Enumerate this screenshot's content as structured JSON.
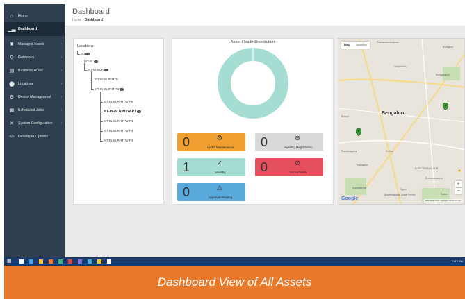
{
  "sidebar": {
    "items": [
      {
        "label": "Home",
        "icon": "home-icon",
        "glyph": "⌂",
        "chevron": ""
      },
      {
        "label": "Dashboard",
        "icon": "chart-icon",
        "glyph": "▁▃",
        "chevron": ""
      },
      {
        "label": "Managed Assets",
        "icon": "assets-icon",
        "glyph": "♜",
        "chevron": "›"
      },
      {
        "label": "Gateways",
        "icon": "usb-icon",
        "glyph": "⚲",
        "chevron": "›"
      },
      {
        "label": "Business Rules",
        "icon": "document-icon",
        "glyph": "▤",
        "chevron": "›"
      },
      {
        "label": "Locations",
        "icon": "map-marker-icon",
        "glyph": "⬤",
        "chevron": "›"
      },
      {
        "label": "Device Management",
        "icon": "gear-icon",
        "glyph": "⚙",
        "chevron": "›"
      },
      {
        "label": "Scheduled Jobs",
        "icon": "calendar-icon",
        "glyph": "▦",
        "chevron": "›"
      },
      {
        "label": "System Configuration",
        "icon": "wrench-icon",
        "glyph": "✕",
        "chevron": "›"
      },
      {
        "label": "Developer Options",
        "icon": "code-icon",
        "glyph": "</>",
        "chevron": ""
      }
    ]
  },
  "header": {
    "title": "Dashboard",
    "breadcrumb_home": "Home",
    "breadcrumb_sep": " › ",
    "breadcrumb_current": "Dashboard"
  },
  "locations": {
    "title": "Locations",
    "nodes": [
      {
        "label": "M1"
      },
      {
        "label": "MT-IN"
      },
      {
        "label": "MT-IN-BLR"
      },
      {
        "label": "MT-IN-BLR-MTE"
      },
      {
        "label": "MT-IN-BLR-MTW"
      },
      {
        "label": "MT-IN-BLR-MTW-P5"
      },
      {
        "label": "MT-IN-BLR-MTW-P1"
      },
      {
        "label": "MT-IN-BLR-MTW-P3"
      },
      {
        "label": "MT-IN-BLR-MTW-P4"
      },
      {
        "label": "MT-IN-BLR-MTW-P2"
      }
    ]
  },
  "asset_health": {
    "title": "Asset Health Distribution",
    "tiles": [
      {
        "count": "0",
        "label": "Under Maintenance",
        "icon": "wrench-gear-icon",
        "glyph": "⚙",
        "color": "#f0a030"
      },
      {
        "count": "0",
        "label": "Awaiting Registration",
        "icon": "minus-circle-icon",
        "glyph": "⊖",
        "color": "#d9d9d9"
      },
      {
        "count": "1",
        "label": "Healthy",
        "icon": "check-circle-icon",
        "glyph": "✓",
        "color": "#a6ddd2"
      },
      {
        "count": "0",
        "label": "Unreachable",
        "icon": "ban-icon",
        "glyph": "⊘",
        "color": "#e5505f"
      },
      {
        "count": "0",
        "label": "Approval Pending",
        "icon": "warning-icon",
        "glyph": "⚠",
        "color": "#5aa9dc"
      }
    ]
  },
  "chart_data": {
    "type": "pie",
    "title": "Asset Health Distribution",
    "categories": [
      "Healthy"
    ],
    "values": [
      1
    ],
    "colors": [
      "#a6ddd2"
    ]
  },
  "map": {
    "tab_map": "Map",
    "tab_satellite": "Satellite",
    "city": "Bengaluru",
    "labels": [
      "Ramachandrapura",
      "Budigere",
      "Yelahanka",
      "Bidadi",
      "Bangarapet",
      "Kothur",
      "Thurugere",
      "ELECTRONIC CITY",
      "Bommasandra",
      "Ramanagara",
      "Kaggalipura",
      "Jigani",
      "Bannerghatta State Forest",
      "Malur"
    ],
    "google": "Google",
    "terms": "Map data ©2017 Google   Terms of Use",
    "marker_color": "#3c9a3c"
  },
  "taskbar": {
    "clock": "10:15 AM",
    "icon_colors": [
      "#ffffff",
      "#4aa3e0",
      "#f3c13a",
      "#e8792b",
      "#3cb371",
      "#d84a4a",
      "#8a6fd8",
      "#4aa3e0",
      "#f3c13a",
      "#ffffff"
    ]
  },
  "caption": "Dashboard View of All Assets"
}
